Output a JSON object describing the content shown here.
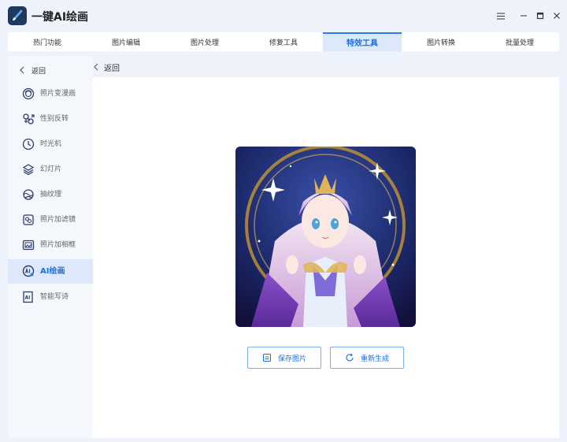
{
  "app": {
    "title": "一键AI绘画",
    "accent_color": "#2f7be6"
  },
  "window_controls": [
    "menu-icon",
    "minimize-icon",
    "maximize-icon",
    "close-icon"
  ],
  "top_nav": {
    "tabs": [
      {
        "label": "热门功能",
        "active": false
      },
      {
        "label": "图片编辑",
        "active": false
      },
      {
        "label": "图片处理",
        "active": false
      },
      {
        "label": "修复工具",
        "active": false
      },
      {
        "label": "特效工具",
        "active": true
      },
      {
        "label": "图片转换",
        "active": false
      },
      {
        "label": "批量处理",
        "active": false
      }
    ]
  },
  "sidebar": {
    "back_label": "返回",
    "items": [
      {
        "label": "照片变漫画",
        "icon": "face-icon",
        "active": false
      },
      {
        "label": "性别反转",
        "icon": "gender-icon",
        "active": false
      },
      {
        "label": "时光机",
        "icon": "clock-icon",
        "active": false
      },
      {
        "label": "幻灯片",
        "icon": "layers-icon",
        "active": false
      },
      {
        "label": "抽纹理",
        "icon": "texture-icon",
        "active": false
      },
      {
        "label": "照片加滤镜",
        "icon": "filter-icon",
        "active": false
      },
      {
        "label": "照片加相框",
        "icon": "frame-icon",
        "active": false
      },
      {
        "label": "AI绘画",
        "icon": "ai-paint-icon",
        "active": true
      },
      {
        "label": "智能写诗",
        "icon": "ai-doc-icon",
        "active": false
      }
    ]
  },
  "main": {
    "back_label": "返回",
    "image_subject": "anime-girl-artwork",
    "actions": {
      "save_label": "保存图片",
      "regenerate_label": "重新生成"
    }
  }
}
